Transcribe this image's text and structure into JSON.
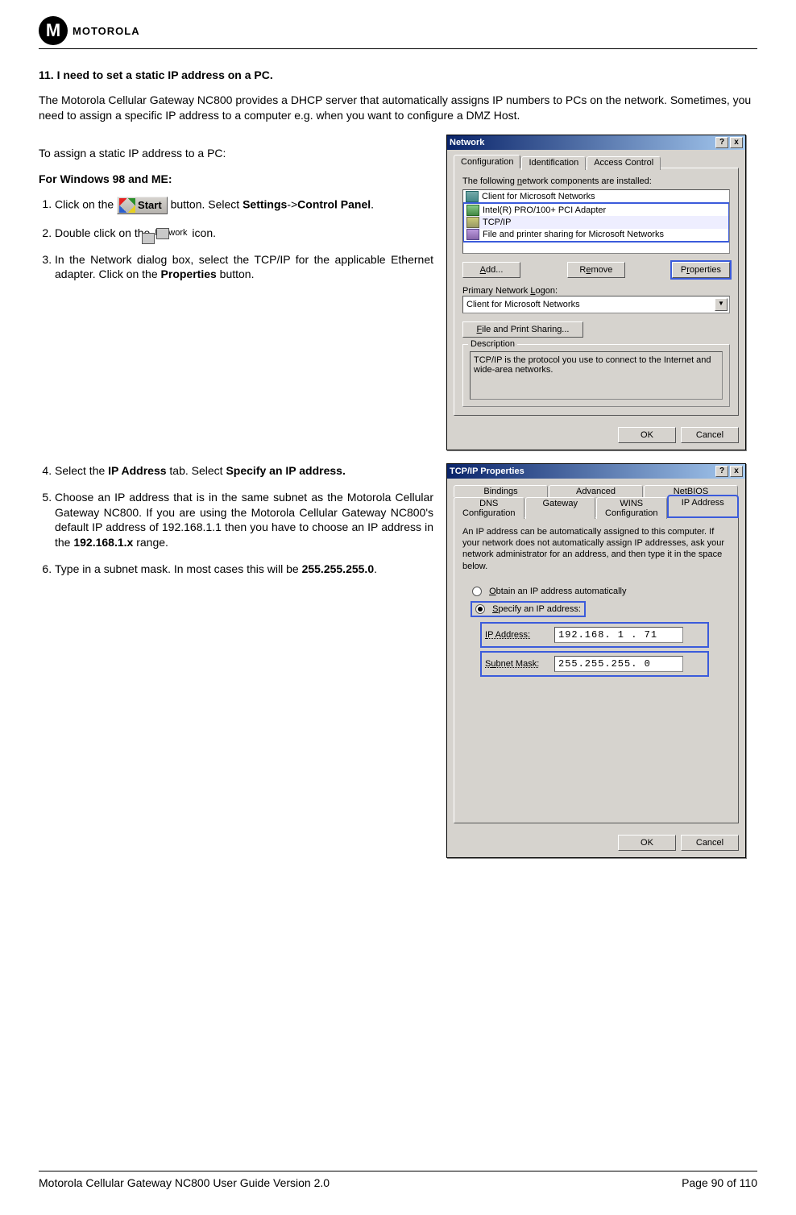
{
  "header": {
    "brand": "MOTOROLA"
  },
  "question": {
    "number": "11.",
    "text": "I need to set a static IP address on a PC."
  },
  "intro": "The Motorola Cellular Gateway NC800 provides a DHCP server that automatically assigns IP numbers to PCs on the network. Sometimes, you need to assign a specific IP address to a computer e.g. when you want to configure a DMZ Host.",
  "lead": "To assign a static IP address to a PC:",
  "subhead": "For Windows 98 and ME:",
  "start_button_label": "Start",
  "steps_a": {
    "s1_pre": "Click on the ",
    "s1_post": " button. Select ",
    "s1_b1": "Settings",
    "s1_mid": "->",
    "s1_b2": "Control Panel",
    "s1_end": ".",
    "s2_pre": "Double click on the ",
    "s2_post": " icon.",
    "network_label": "Network",
    "s3_a": "In the Network dialog box, select the TCP/IP for the applicable Ethernet adapter. Click on the ",
    "s3_b": "Properties",
    "s3_c": " button."
  },
  "steps_b": {
    "s4_a": "Select the ",
    "s4_b": "IP Address",
    "s4_c": " tab. Select ",
    "s4_d": "Specify an IP address.",
    "s5_a": "Choose an IP address that is in the same subnet as the Motorola Cellular Gateway NC800. If you are using the Motorola Cellular Gateway NC800's default IP address of 192.168.1.1 then you have to choose an IP address in the ",
    "s5_b": "192.168.1.x",
    "s5_c": " range.",
    "s6_a": "Type in a subnet mask. In most cases this will be ",
    "s6_b": "255.255.255.0",
    "s6_c": "."
  },
  "dlg_network": {
    "title": "Network",
    "help": "?",
    "close": "x",
    "tabs": [
      "Configuration",
      "Identification",
      "Access Control"
    ],
    "components_label": "The following network components are installed:",
    "items": [
      "Client for Microsoft Networks",
      "Intel(R) PRO/100+ PCI Adapter",
      "TCP/IP",
      "File and printer sharing for Microsoft Networks"
    ],
    "add": "Add...",
    "remove": "Remove",
    "properties": "Properties",
    "logon_label": "Primary Network Logon:",
    "logon_value": "Client for Microsoft Networks",
    "file_share": "File and Print Sharing...",
    "desc_legend": "Description",
    "desc_text": "TCP/IP is the protocol you use to connect to the Internet and wide-area networks.",
    "ok": "OK",
    "cancel": "Cancel"
  },
  "dlg_tcpip": {
    "title": "TCP/IP Properties",
    "help": "?",
    "close": "x",
    "tabs_row1": [
      "Bindings",
      "Advanced",
      "NetBIOS"
    ],
    "tabs_row2": [
      "DNS Configuration",
      "Gateway",
      "WINS Configuration",
      "IP Address"
    ],
    "note": "An IP address can be automatically assigned to this computer. If your network does not automatically assign IP addresses, ask your network administrator for an address, and then type it in the space below.",
    "opt_auto": "Obtain an IP address automatically",
    "opt_specify": "Specify an IP address:",
    "ip_label": "IP Address:",
    "ip_value": "192.168. 1 . 71",
    "mask_label": "Subnet Mask:",
    "mask_value": "255.255.255. 0",
    "ok": "OK",
    "cancel": "Cancel"
  },
  "footer": {
    "left": "Motorola Cellular Gateway NC800 User Guide Version 2.0",
    "right": "Page 90 of 110"
  }
}
